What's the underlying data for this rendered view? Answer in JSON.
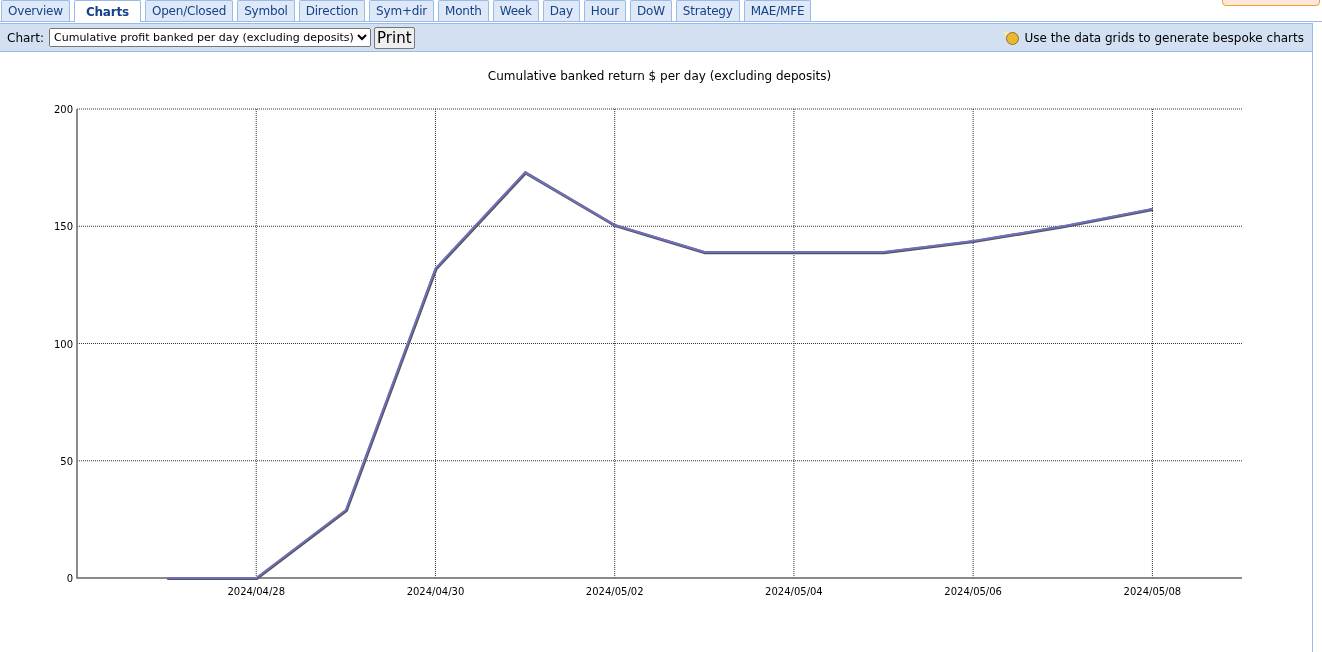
{
  "tabs": [
    {
      "label": "Overview",
      "selected": false
    },
    {
      "label": "Charts",
      "selected": true
    },
    {
      "label": "Open/Closed",
      "selected": false
    },
    {
      "label": "Symbol",
      "selected": false
    },
    {
      "label": "Direction",
      "selected": false
    },
    {
      "label": "Sym+dir",
      "selected": false
    },
    {
      "label": "Month",
      "selected": false
    },
    {
      "label": "Week",
      "selected": false
    },
    {
      "label": "Day",
      "selected": false
    },
    {
      "label": "Hour",
      "selected": false
    },
    {
      "label": "DoW",
      "selected": false
    },
    {
      "label": "Strategy",
      "selected": false
    },
    {
      "label": "MAE/MFE",
      "selected": false
    }
  ],
  "toolbar": {
    "chart_label": "Chart:",
    "chart_select": "Cumulative profit banked per day (excluding deposits)",
    "print_button": "Print",
    "hint": "Use the data grids to generate bespoke charts"
  },
  "chart": {
    "chart_data": {
      "type": "line",
      "title": "Cumulative banked return $ per day (excluding deposits)",
      "categories": [
        null,
        "2024/04/28",
        null,
        "2024/04/30",
        null,
        "2024/05/02",
        null,
        "2024/05/04",
        null,
        "2024/05/06",
        null,
        "2024/05/08"
      ],
      "series": [
        {
          "color": "#6f6fc0",
          "values": [
            0,
            0,
            29,
            132,
            173,
            150.5,
            139,
            139,
            139,
            143.7,
            150,
            157.4
          ]
        }
      ],
      "ylim": [
        0,
        200
      ],
      "grid": true,
      "yticks": [
        0,
        50,
        100,
        150,
        200
      ]
    }
  }
}
